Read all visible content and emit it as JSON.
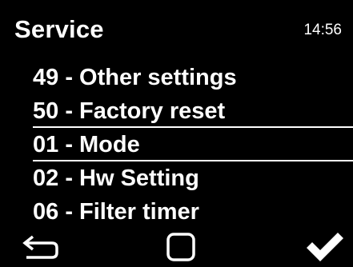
{
  "header": {
    "title": "Service",
    "clock": "14:56"
  },
  "menu": {
    "items": [
      {
        "label": "49 - Other settings"
      },
      {
        "label": "50 - Factory reset"
      },
      {
        "label": "01 - Mode"
      },
      {
        "label": "02 - Hw Setting"
      },
      {
        "label": "06 - Filter timer"
      }
    ],
    "selected_label": "01 - Mode"
  },
  "softkeys": {
    "back_icon": "back-arrow-icon",
    "home_icon": "square-icon",
    "ok_icon": "checkmark-icon"
  },
  "colors": {
    "background": "#000000",
    "foreground": "#ffffff"
  }
}
